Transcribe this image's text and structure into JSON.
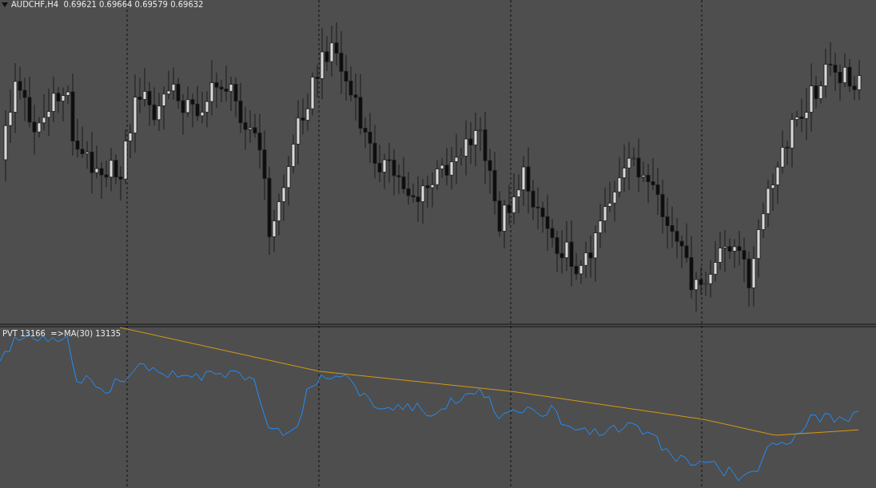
{
  "chart": {
    "symbol_line": "AUDCHF,H4  0.69621 0.69664 0.69579 0.69632"
  },
  "indicator": {
    "label": "PVT 13166  =>MA(30) 13135"
  }
}
